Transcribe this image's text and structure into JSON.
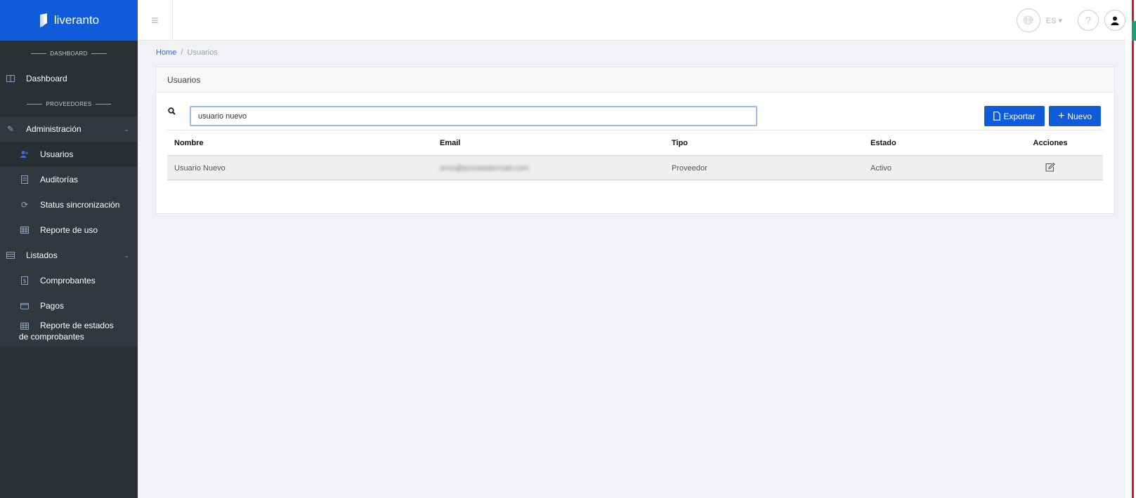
{
  "brand": {
    "name": "liveranto",
    "color": "#0f5bd9"
  },
  "sidebar": {
    "sections": [
      "DASHBOARD",
      "PROVEEDORES"
    ],
    "dashboard": {
      "label": "Dashboard",
      "icon": "columns-icon"
    },
    "admin": {
      "label": "Administración",
      "icon": "wrench-icon"
    },
    "admin_items": [
      {
        "label": "Usuarios",
        "icon": "users-icon",
        "active": true
      },
      {
        "label": "Auditorías",
        "icon": "document-icon"
      },
      {
        "label": "Status sincronización",
        "icon": "sync-icon"
      },
      {
        "label": "Reporte de uso",
        "icon": "table-icon"
      }
    ],
    "listados": {
      "label": "Listados",
      "icon": "list-icon"
    },
    "listados_items": [
      {
        "label": "Comprobantes",
        "icon": "receipt-icon"
      },
      {
        "label": "Pagos",
        "icon": "wallet-icon"
      },
      {
        "label_line1": "Reporte de estados",
        "label_line2": "de comprobantes",
        "icon": "table-icon"
      }
    ]
  },
  "topbar": {
    "language": "ES"
  },
  "breadcrumb": {
    "home": "Home",
    "current": "Usuarios"
  },
  "card": {
    "title": "Usuarios"
  },
  "search": {
    "value": "usuario nuevo"
  },
  "buttons": {
    "export": "Exportar",
    "new": "Nuevo"
  },
  "table": {
    "headers": {
      "nombre": "Nombre",
      "email": "Email",
      "tipo": "Tipo",
      "estado": "Estado",
      "acciones": "Acciones"
    },
    "rows": [
      {
        "nombre": "Usuario Nuevo",
        "email": "ernu@proveedormail.com",
        "tipo": "Proveedor",
        "estado": "Activo"
      }
    ]
  }
}
